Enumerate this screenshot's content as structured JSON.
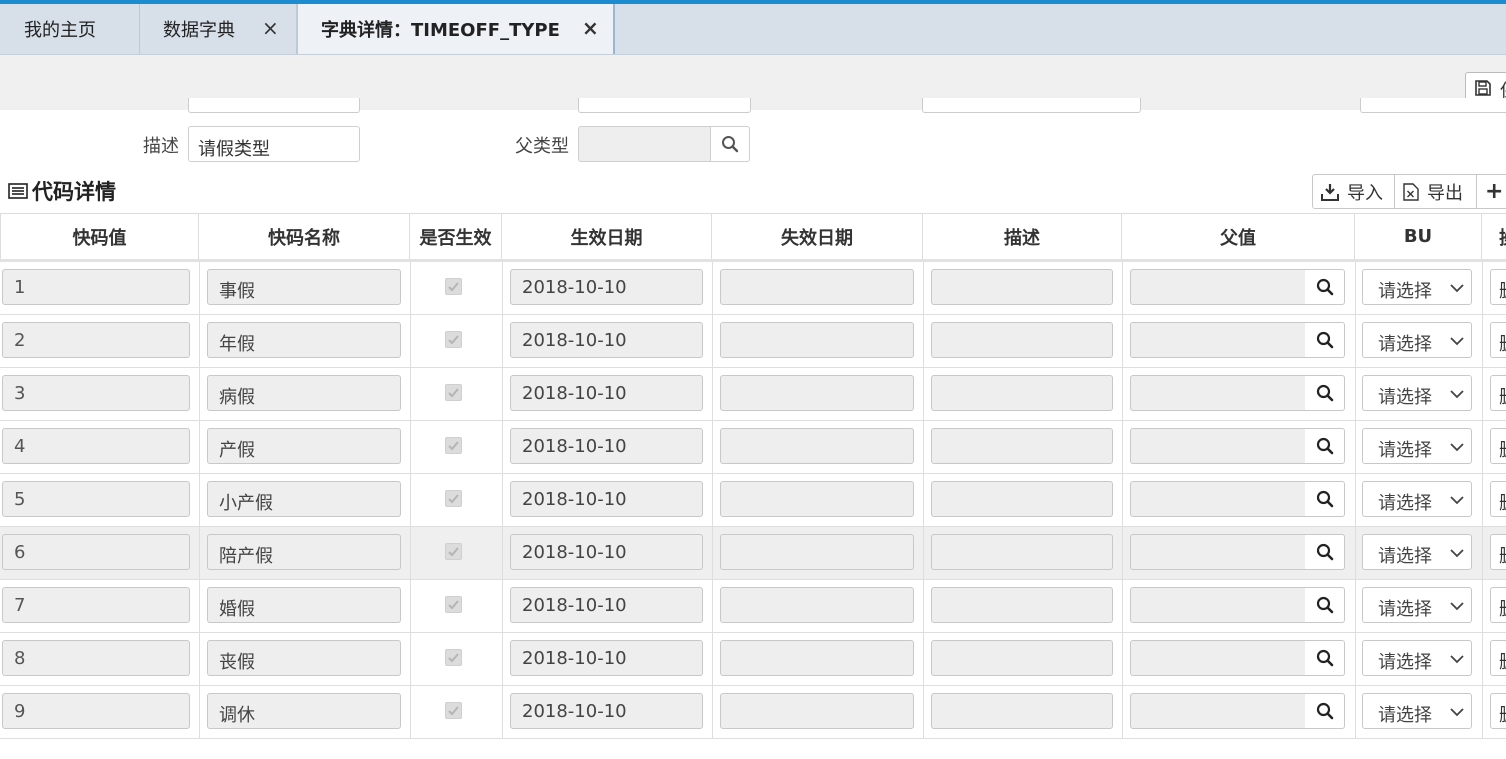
{
  "tabs": [
    {
      "label": "我的主页"
    },
    {
      "label": "数据字典",
      "close": "×"
    },
    {
      "label": "字典详情：TIMEOFF_TYPE",
      "close": "×"
    }
  ],
  "toolbar": {
    "save_label": "保"
  },
  "form": {
    "desc_label": "描述",
    "desc_value": "请假类型",
    "parent_type_label": "父类型",
    "parent_type_value": ""
  },
  "section": {
    "title": "代码详情",
    "import_label": "导入",
    "export_label": "导出",
    "add_label": "+"
  },
  "table": {
    "headers": [
      "快码值",
      "快码名称",
      "是否生效",
      "生效日期",
      "失效日期",
      "描述",
      "父值",
      "BU",
      "操"
    ],
    "select_placeholder": "请选择",
    "action_label": "删",
    "rows": [
      {
        "code": "1",
        "name": "事假",
        "enabled": true,
        "start_date": "2018-10-10",
        "end_date": "",
        "desc": "",
        "parent": ""
      },
      {
        "code": "2",
        "name": "年假",
        "enabled": true,
        "start_date": "2018-10-10",
        "end_date": "",
        "desc": "",
        "parent": ""
      },
      {
        "code": "3",
        "name": "病假",
        "enabled": true,
        "start_date": "2018-10-10",
        "end_date": "",
        "desc": "",
        "parent": ""
      },
      {
        "code": "4",
        "name": "产假",
        "enabled": true,
        "start_date": "2018-10-10",
        "end_date": "",
        "desc": "",
        "parent": ""
      },
      {
        "code": "5",
        "name": "小产假",
        "enabled": true,
        "start_date": "2018-10-10",
        "end_date": "",
        "desc": "",
        "parent": ""
      },
      {
        "code": "6",
        "name": "陪产假",
        "enabled": true,
        "start_date": "2018-10-10",
        "end_date": "",
        "desc": "",
        "parent": ""
      },
      {
        "code": "7",
        "name": "婚假",
        "enabled": true,
        "start_date": "2018-10-10",
        "end_date": "",
        "desc": "",
        "parent": ""
      },
      {
        "code": "8",
        "name": "丧假",
        "enabled": true,
        "start_date": "2018-10-10",
        "end_date": "",
        "desc": "",
        "parent": ""
      },
      {
        "code": "9",
        "name": "调休",
        "enabled": true,
        "start_date": "2018-10-10",
        "end_date": "",
        "desc": "",
        "parent": ""
      }
    ]
  }
}
